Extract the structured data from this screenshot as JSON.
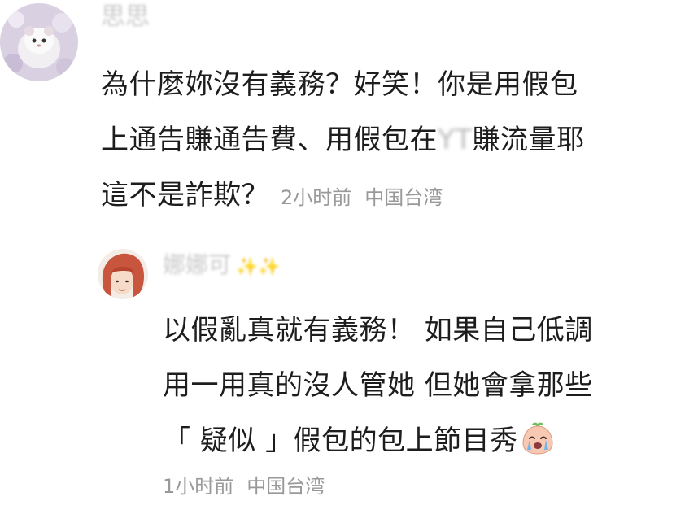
{
  "comments": [
    {
      "username": "思思",
      "lines": [
        "為什麼妳沒有義務？好笑！你是用假包",
        "上通告賺通告費、用假包在",
        "賺流量耶",
        "這不是詐欺？"
      ],
      "redacted": "YT",
      "time": "2小时前",
      "location": "中国台湾"
    },
    {
      "username": "娜娜可",
      "sparkle": "✨✨",
      "lines": [
        "以假亂真就有義務！ 如果自己低調",
        "用一用真的沒人管她 但她會拿那些",
        "「 疑似 」假包的包上節目秀"
      ],
      "emoji": "crying-face-emoji",
      "time": "1小时前",
      "location": "中国台湾"
    }
  ]
}
